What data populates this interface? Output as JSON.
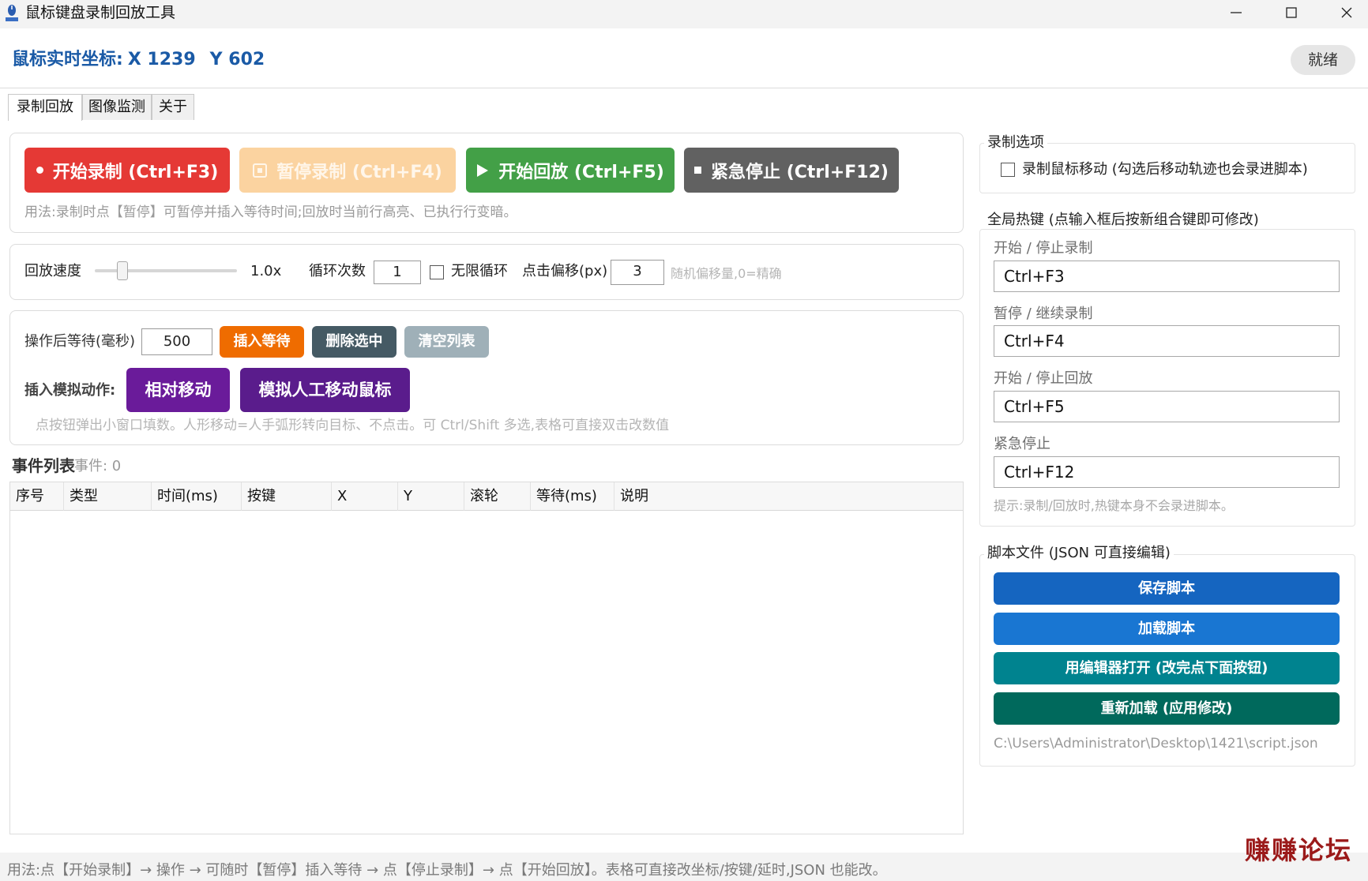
{
  "window": {
    "title": "鼠标键盘录制回放工具"
  },
  "header": {
    "coord_prefix": "鼠标实时坐标:",
    "x_text": "X 1239",
    "y_text": "Y 602",
    "status": "就绪"
  },
  "tabs": [
    {
      "label": "录制回放",
      "active": true
    },
    {
      "label": "图像监测",
      "active": false
    },
    {
      "label": "关于",
      "active": false
    }
  ],
  "controls": {
    "start_record": "开始录制 (Ctrl+F3)",
    "pause_record": "暂停录制 (Ctrl+F4)",
    "start_playback": "开始回放 (Ctrl+F5)",
    "emergency_stop": "紧急停止 (Ctrl+F12)",
    "usage_hint": "用法:录制时点【暂停】可暂停并插入等待时间;回放时当前行高亮、已执行行变暗。"
  },
  "playback": {
    "speed_label": "回放速度",
    "speed_value_text": "1.0x",
    "speed_level": 0.17,
    "loop_label": "循环次数",
    "loop_value": "1",
    "infinite_label": "无限循环",
    "offset_label": "点击偏移(px)",
    "offset_value": "3",
    "offset_hint": "随机偏移量,0=精确"
  },
  "insert": {
    "wait_label": "操作后等待(毫秒)",
    "wait_value": "500",
    "insert_wait": "插入等待",
    "delete_selected": "删除选中",
    "clear_list": "清空列表",
    "sim_label": "插入模拟动作:",
    "relative_move": "相对移动",
    "human_move": "模拟人工移动鼠标",
    "hint": "点按钮弹出小窗口填数。人形移动=人手弧形转向目标、不点击。可 Ctrl/Shift 多选,表格可直接双击改数值"
  },
  "events": {
    "title": "事件列表",
    "count_text": "事件: 0",
    "columns": [
      "序号",
      "类型",
      "时间(ms)",
      "按键",
      "X",
      "Y",
      "滚轮",
      "等待(ms)",
      "说明"
    ]
  },
  "record_options": {
    "title": "录制选项",
    "record_mouse_move": "录制鼠标移动 (勾选后移动轨迹也会录进脚本)"
  },
  "hotkeys": {
    "title": "全局热键 (点输入框后按新组合键即可修改)",
    "items": [
      {
        "label": "开始 / 停止录制",
        "value": "Ctrl+F3"
      },
      {
        "label": "暂停 / 继续录制",
        "value": "Ctrl+F4"
      },
      {
        "label": "开始 / 停止回放",
        "value": "Ctrl+F5"
      },
      {
        "label": "紧急停止",
        "value": "Ctrl+F12"
      }
    ],
    "hint": "提示:录制/回放时,热键本身不会录进脚本。"
  },
  "script": {
    "title": "脚本文件 (JSON 可直接编辑)",
    "save": "保存脚本",
    "load": "加载脚本",
    "open_editor": "用编辑器打开 (改完点下面按钮)",
    "reload": "重新加载 (应用修改)",
    "path": "C:\\Users\\Administrator\\Desktop\\1421\\script.json"
  },
  "footer": {
    "usage": "用法:点【开始录制】→ 操作 → 可随时【暂停】插入等待 → 点【停止录制】→ 点【开始回放】。表格可直接改坐标/按键/延时,JSON 也能改。",
    "watermark": "赚赚论坛"
  },
  "colors": {
    "record_red": "#e53935",
    "pause_peach": "#fbd3a0",
    "play_green": "#43a047",
    "stop_gray": "#616161",
    "insert_orange": "#ef6c00",
    "delete_slate": "#455a64",
    "clear_gray": "#9fb0b8",
    "purple": "#6a1b9a",
    "deep_purple": "#5a1c8c",
    "save_blue": "#1565c0",
    "load_blue": "#1976d2",
    "editor_teal": "#00838f",
    "reload_green": "#00695c",
    "coord_blue": "#1a5aa6"
  }
}
